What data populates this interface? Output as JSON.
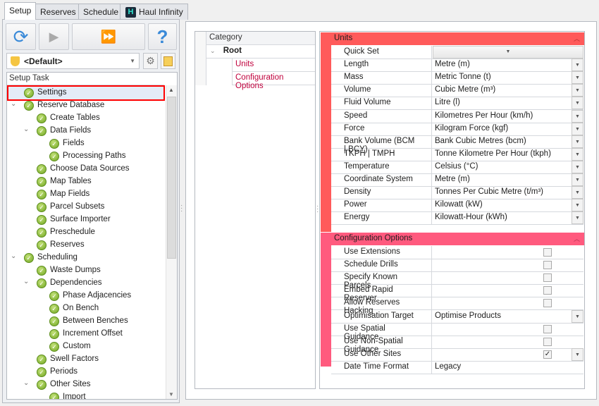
{
  "tabs": [
    "Setup",
    "Reserves",
    "Schedule",
    "Haul Infinity"
  ],
  "toolbar": {
    "help": "?"
  },
  "profile": {
    "selected": "<Default>"
  },
  "tree": {
    "header": "Setup Task",
    "items": [
      {
        "label": "Settings",
        "level": 0,
        "selected": true
      },
      {
        "label": "Reserve Database",
        "level": 0,
        "expander": true
      },
      {
        "label": "Create Tables",
        "level": 1
      },
      {
        "label": "Data Fields",
        "level": 1,
        "expander": true
      },
      {
        "label": "Fields",
        "level": 2
      },
      {
        "label": "Processing Paths",
        "level": 2
      },
      {
        "label": "Choose Data Sources",
        "level": 1
      },
      {
        "label": "Map Tables",
        "level": 1
      },
      {
        "label": "Map Fields",
        "level": 1
      },
      {
        "label": "Parcel Subsets",
        "level": 1
      },
      {
        "label": "Surface Importer",
        "level": 1
      },
      {
        "label": "Preschedule",
        "level": 1
      },
      {
        "label": "Reserves",
        "level": 1
      },
      {
        "label": "Scheduling",
        "level": 0,
        "expander": true
      },
      {
        "label": "Waste Dumps",
        "level": 1
      },
      {
        "label": "Dependencies",
        "level": 1,
        "expander": true
      },
      {
        "label": "Phase Adjacencies",
        "level": 2
      },
      {
        "label": "On Bench",
        "level": 2
      },
      {
        "label": "Between Benches",
        "level": 2
      },
      {
        "label": "Increment Offset",
        "level": 2
      },
      {
        "label": "Custom",
        "level": 2
      },
      {
        "label": "Swell Factors",
        "level": 1
      },
      {
        "label": "Periods",
        "level": 1
      },
      {
        "label": "Other Sites",
        "level": 1,
        "expander": true
      },
      {
        "label": "Import",
        "level": 2
      }
    ]
  },
  "category": {
    "header": "Category",
    "root": "Root",
    "items": [
      "Units",
      "Configuration Options"
    ]
  },
  "colors": {
    "units_header": "#ff5a5a",
    "config_header": "#ff5a7e",
    "category_text": "#c0003c"
  },
  "units": {
    "title": "Units",
    "rows": [
      {
        "name": "Quick Set",
        "value": ""
      },
      {
        "name": "Length",
        "value": "Metre (m)"
      },
      {
        "name": "Mass",
        "value": "Metric Tonne (t)"
      },
      {
        "name": "Volume",
        "value": "Cubic Metre (m³)"
      },
      {
        "name": "Fluid Volume",
        "value": "Litre (l)"
      },
      {
        "name": "Speed",
        "value": "Kilometres Per Hour (km/h)"
      },
      {
        "name": "Force",
        "value": "Kilogram Force (kgf)"
      },
      {
        "name": "Bank Volume (BCM | BCY)",
        "value": "Bank Cubic Metres (bcm)"
      },
      {
        "name": "TKPH | TMPH",
        "value": "Tonne Kilometre Per Hour (tkph)"
      },
      {
        "name": "Temperature",
        "value": "Celsius (°C)"
      },
      {
        "name": "Coordinate System",
        "value": "Metre (m)"
      },
      {
        "name": "Density",
        "value": "Tonnes Per Cubic Metre (t/m³)"
      },
      {
        "name": "Power",
        "value": "Kilowatt (kW)"
      },
      {
        "name": "Energy",
        "value": "Kilowatt-Hour (kWh)"
      }
    ]
  },
  "config": {
    "title": "Configuration Options",
    "rows": [
      {
        "name": "Use Extensions",
        "checked": false
      },
      {
        "name": "Schedule Drills",
        "checked": false
      },
      {
        "name": "Specify Known Parcels",
        "checked": false
      },
      {
        "name": "Embed Rapid Reserver",
        "checked": false
      },
      {
        "name": "Allow Reserves Hacking",
        "checked": false
      },
      {
        "name": "Optimisation Target",
        "value": "Optimise Products",
        "dropdown": true
      },
      {
        "name": "Use Spatial Guidance",
        "checked": false
      },
      {
        "name": "Use Non-Spatial Guidance",
        "checked": false
      },
      {
        "name": "Use Other Sites",
        "checked": true,
        "dropdown": true
      },
      {
        "name": "Date Time Format",
        "value": "Legacy"
      }
    ]
  }
}
